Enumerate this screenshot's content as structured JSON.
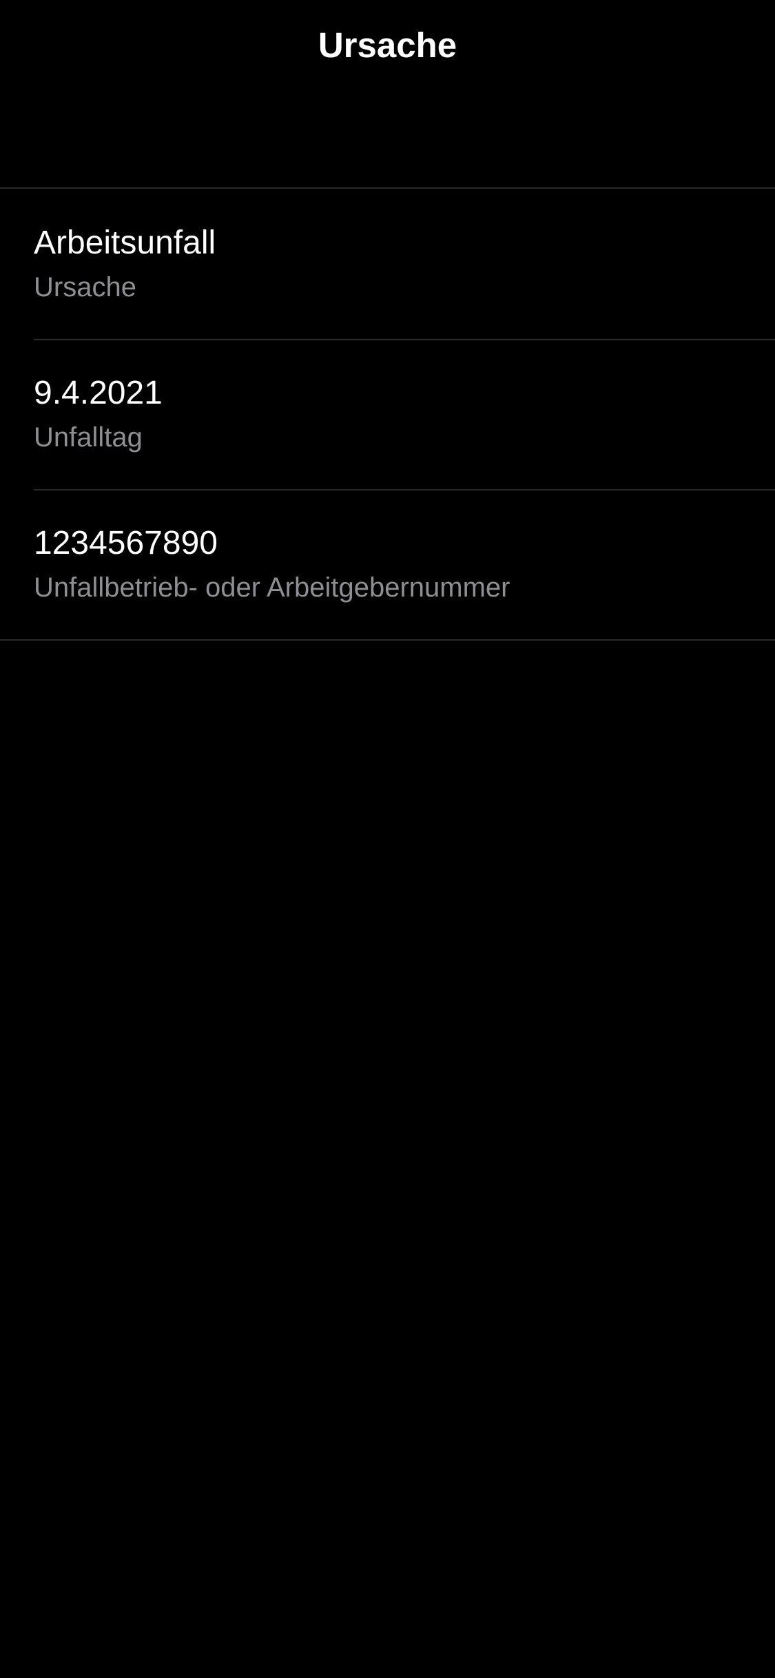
{
  "nav": {
    "title": "Ursache"
  },
  "rows": [
    {
      "value": "Arbeitsunfall",
      "label": "Ursache"
    },
    {
      "value": "9.4.2021",
      "label": "Unfalltag"
    },
    {
      "value": "1234567890",
      "label": "Unfallbetrieb- oder Arbeitgebernummer"
    }
  ],
  "colors": {
    "background": "#000000",
    "primary_text": "#ffffff",
    "secondary_text": "#8e8e93",
    "separator": "#2a2a2c"
  }
}
